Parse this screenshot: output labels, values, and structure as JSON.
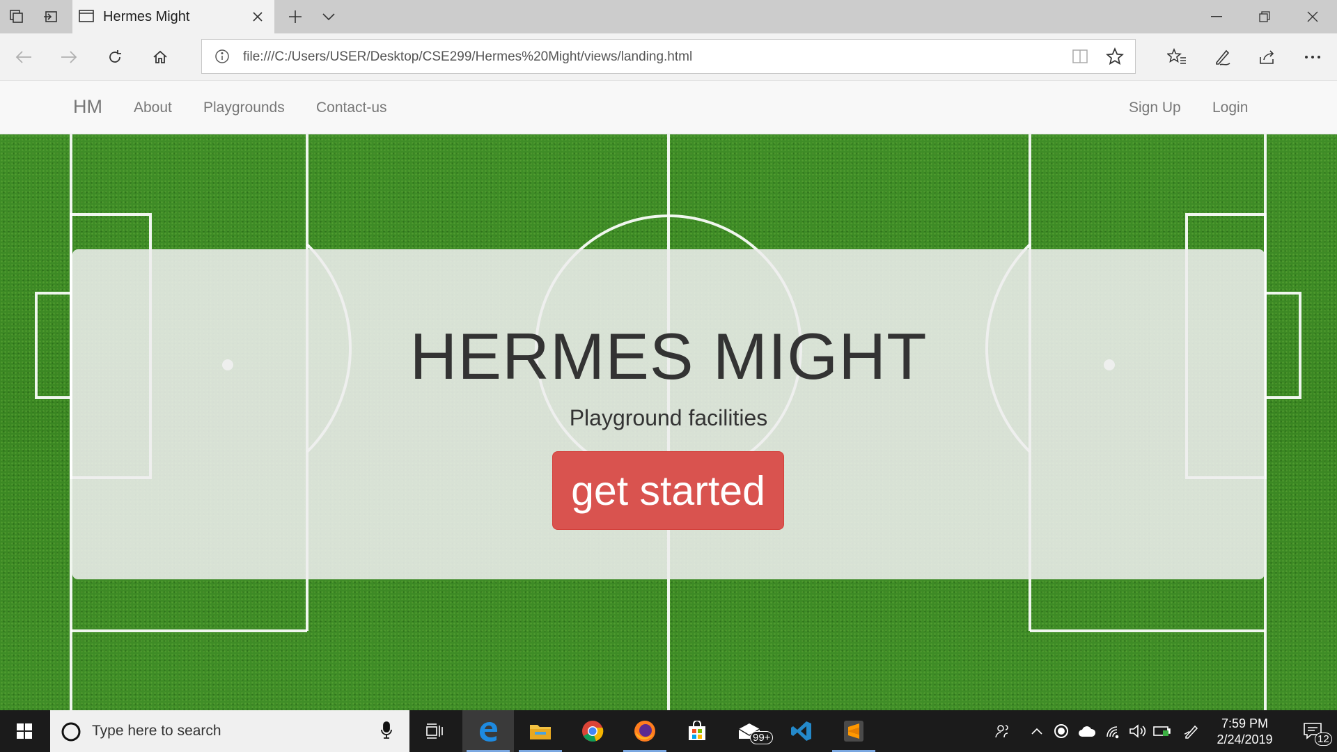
{
  "browser": {
    "tab_title": "Hermes Might",
    "url": "file:///C:/Users/USER/Desktop/CSE299/Hermes%20Might/views/landing.html"
  },
  "navbar": {
    "brand": "HM",
    "links": [
      "About",
      "Playgrounds",
      "Contact-us"
    ],
    "right_links": [
      "Sign Up",
      "Login"
    ]
  },
  "hero": {
    "title": "HERMES MIGHT",
    "subtitle": "Playground facilities",
    "button": "get started"
  },
  "taskbar": {
    "search_placeholder": "Type here to search",
    "mail_badge": "99+",
    "time": "7:59 PM",
    "date": "2/24/2019",
    "notification_count": "12"
  },
  "colors": {
    "button": "#d9534f",
    "field_green": "#3e8a26",
    "navbar_bg": "#f8f8f8",
    "taskbar_bg": "#1b1b1b",
    "tabstrip_bg": "#cccccc"
  }
}
